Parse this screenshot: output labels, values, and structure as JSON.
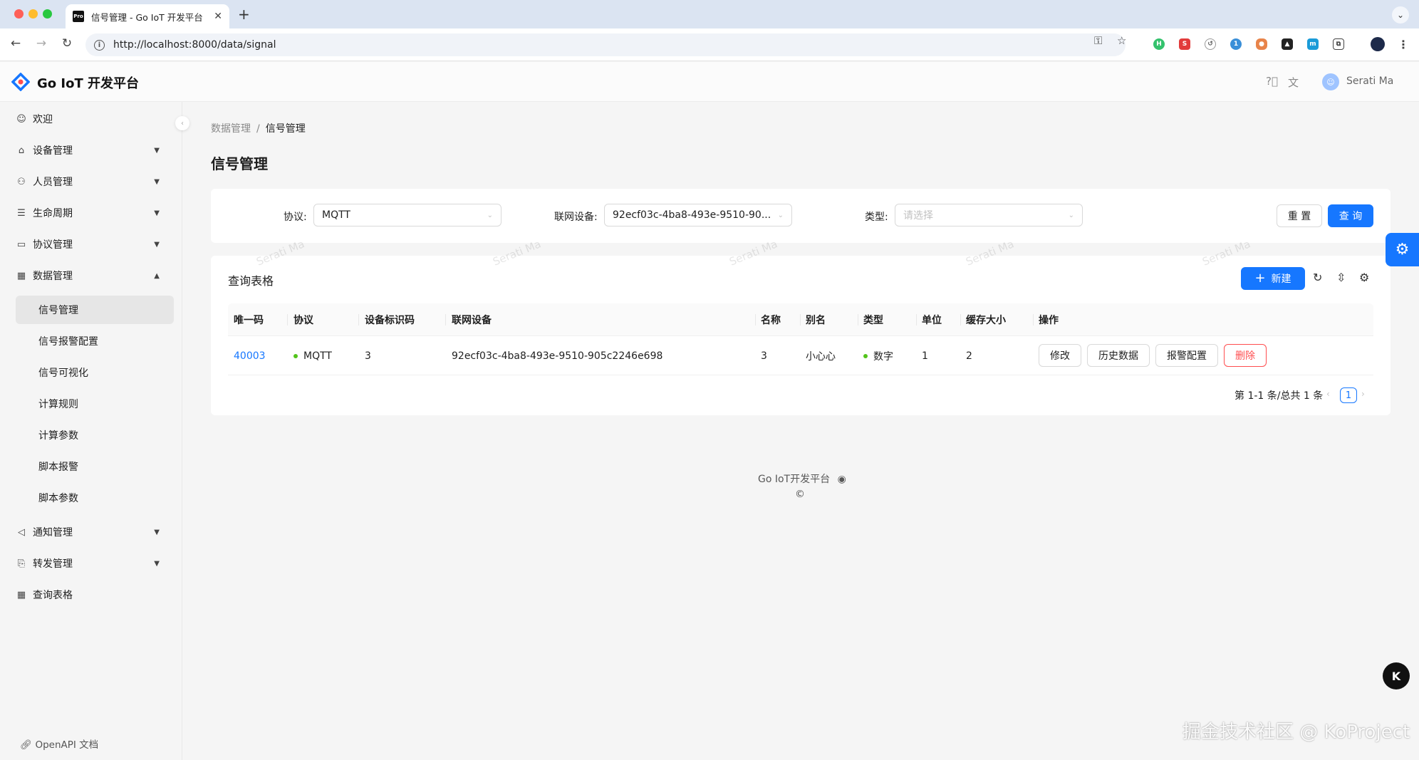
{
  "browser": {
    "tab_title": "信号管理 - Go IoT 开发平台",
    "tab_favicon_text": "Pro",
    "url": "http://localhost:8000/data/signal",
    "extension_badge": "1"
  },
  "header": {
    "brand": "Go IoT 开发平台",
    "username": "Serati Ma"
  },
  "sidebar": {
    "items": [
      {
        "label": "欢迎",
        "icon": "smile-icon"
      },
      {
        "label": "设备管理",
        "icon": "home-icon"
      },
      {
        "label": "人员管理",
        "icon": "user-icon"
      },
      {
        "label": "生命周期",
        "icon": "list-icon"
      },
      {
        "label": "协议管理",
        "icon": "card-icon"
      },
      {
        "label": "数据管理",
        "icon": "table-icon"
      }
    ],
    "data_sub_items": [
      "信号管理",
      "信号报警配置",
      "信号可视化",
      "计算规则",
      "计算参数",
      "脚本报警",
      "脚本参数"
    ],
    "items_after": [
      {
        "label": "通知管理",
        "icon": "sound-icon"
      },
      {
        "label": "转发管理",
        "icon": "forward-icon"
      },
      {
        "label": "查询表格",
        "icon": "table-icon"
      }
    ],
    "openapi": "OpenAPI 文档"
  },
  "breadcrumb": {
    "parent": "数据管理",
    "separator": "/",
    "current": "信号管理"
  },
  "page_title": "信号管理",
  "filter": {
    "protocol_label": "协议:",
    "protocol_value": "MQTT",
    "device_label": "联网设备:",
    "device_value": "92ecf03c-4ba8-493e-9510-90...",
    "type_label": "类型:",
    "type_placeholder": "请选择",
    "reset": "重 置",
    "query": "查 询"
  },
  "table_card": {
    "title": "查询表格",
    "new_button": "新建",
    "columns": [
      "唯一码",
      "协议",
      "设备标识码",
      "联网设备",
      "名称",
      "别名",
      "类型",
      "单位",
      "缓存大小",
      "操作"
    ],
    "rows": [
      {
        "id": "40003",
        "protocol": "MQTT",
        "device_code": "3",
        "device": "92ecf03c-4ba8-493e-9510-905c2246e698",
        "name": "3",
        "alias": "小心心",
        "type": "数字",
        "unit": "1",
        "cache_size": "2",
        "actions": [
          "修改",
          "历史数据",
          "报警配置",
          "删除"
        ]
      }
    ],
    "pagination_total": "第 1-1 条/总共 1 条",
    "current_page": "1"
  },
  "watermark": "Serati Ma",
  "footer": {
    "text": "Go IoT开发平台",
    "copyright": "©"
  },
  "corner_watermark": "掘金技术社区 @ KoProject",
  "float_k": "K",
  "colors": {
    "primary": "#1677ff",
    "danger": "#ff4d4f",
    "status_green": "#52c41a"
  }
}
